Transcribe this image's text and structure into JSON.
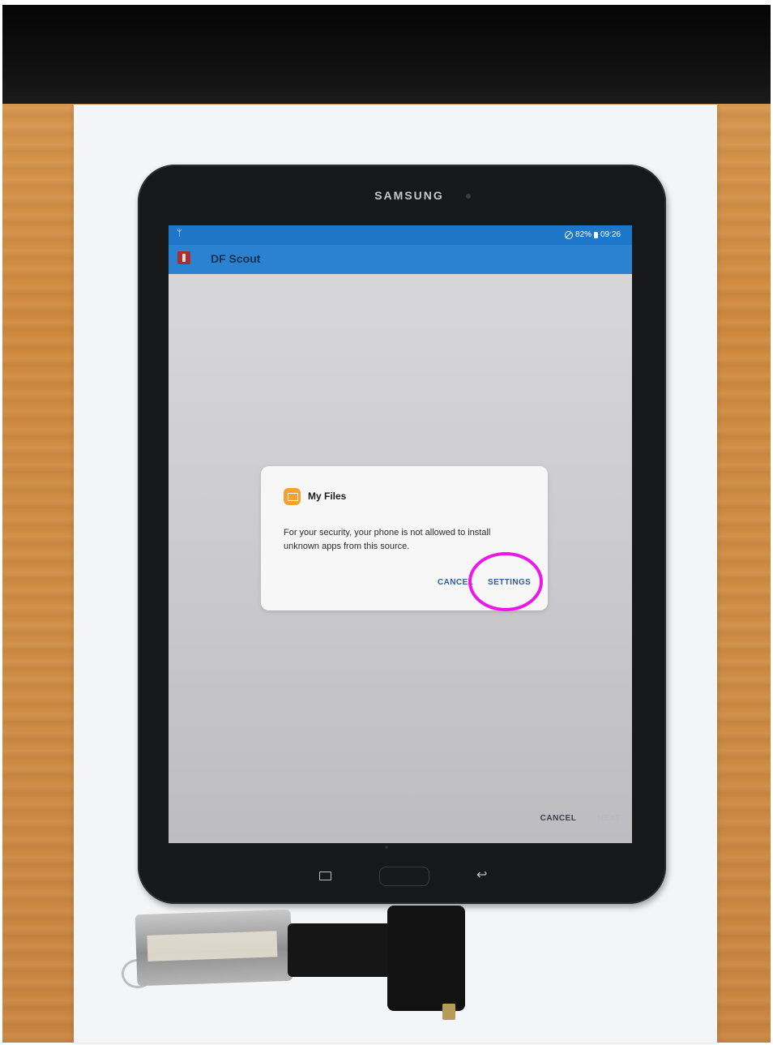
{
  "device": {
    "brand": "SAMSUNG"
  },
  "statusbar": {
    "usb_icon": "usb-icon",
    "battery": "82%",
    "time": "09:26"
  },
  "appbar": {
    "title": "DF Scout",
    "icon": "app-icon"
  },
  "dialog": {
    "app_name": "My Files",
    "icon": "folder-icon",
    "message": "For your security, your phone is not allowed to install unknown apps from this source.",
    "cancel_label": "CANCEL",
    "settings_label": "SETTINGS"
  },
  "bottom_actions": {
    "cancel_label": "CANCEL",
    "next_label": "NEXT"
  },
  "colors": {
    "appbar": "#2a82d1",
    "dialog_button": "#2b5f9c",
    "highlight": "#ec18e9"
  }
}
